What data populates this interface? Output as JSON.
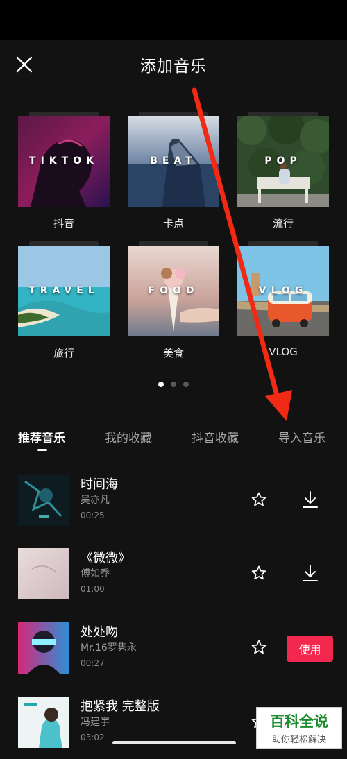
{
  "header": {
    "title": "添加音乐"
  },
  "categories": [
    {
      "en": "TIKTOK",
      "zh": "抖音"
    },
    {
      "en": "BEAT",
      "zh": "卡点"
    },
    {
      "en": "POP",
      "zh": "流行"
    },
    {
      "en": "TRAVEL",
      "zh": "旅行"
    },
    {
      "en": "FOOD",
      "zh": "美食"
    },
    {
      "en": "VLOG",
      "zh": "VLOG"
    }
  ],
  "pager": {
    "pages": 3,
    "current": 1
  },
  "tabs": [
    "推荐音乐",
    "我的收藏",
    "抖音收藏",
    "导入音乐"
  ],
  "songs": [
    {
      "title": "时间海",
      "artist": "吴亦凡",
      "duration": "00:25"
    },
    {
      "title": "《微微》",
      "artist": "傅如乔",
      "duration": "01:00"
    },
    {
      "title": "处处吻",
      "artist": "Mr.16罗隽永",
      "duration": "00:27",
      "action": "使用"
    },
    {
      "title": "抱紧我 完整版",
      "artist": "冯建宇",
      "duration": "03:02"
    }
  ],
  "icons": [
    "close-icon",
    "star-icon",
    "download-icon"
  ],
  "colors": {
    "accent": "#f3284f",
    "arrow": "#f02a14",
    "background": "#121212"
  },
  "watermark": {
    "main": "百科全说",
    "sub": "助你轻松解决"
  }
}
